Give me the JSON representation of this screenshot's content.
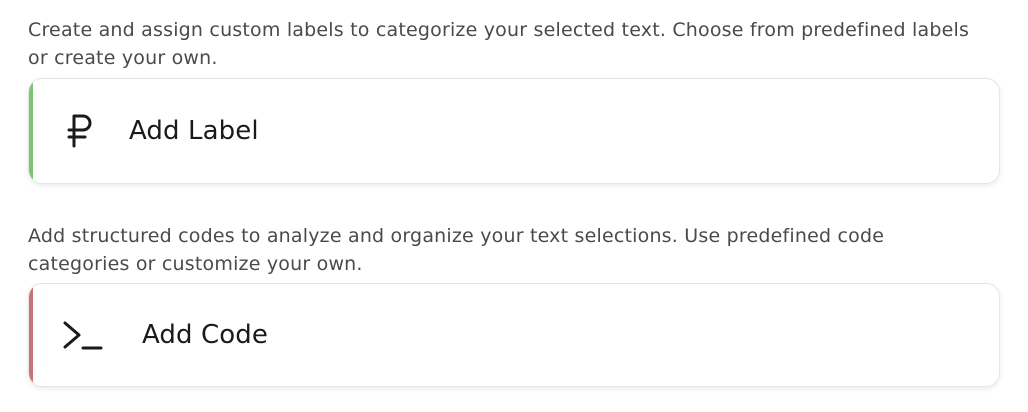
{
  "label_section": {
    "description": "Create and assign custom labels to categorize your selected text. Choose from predefined labels or create your own.",
    "button_label": "Add Label",
    "icon": "ruble-icon",
    "accent_color": "#7cc474"
  },
  "code_section": {
    "description": "Add structured codes to analyze and organize your text selections. Use predefined code categories or customize your own.",
    "button_label": "Add Code",
    "icon": "terminal-prompt-icon",
    "accent_color": "#c97474"
  }
}
